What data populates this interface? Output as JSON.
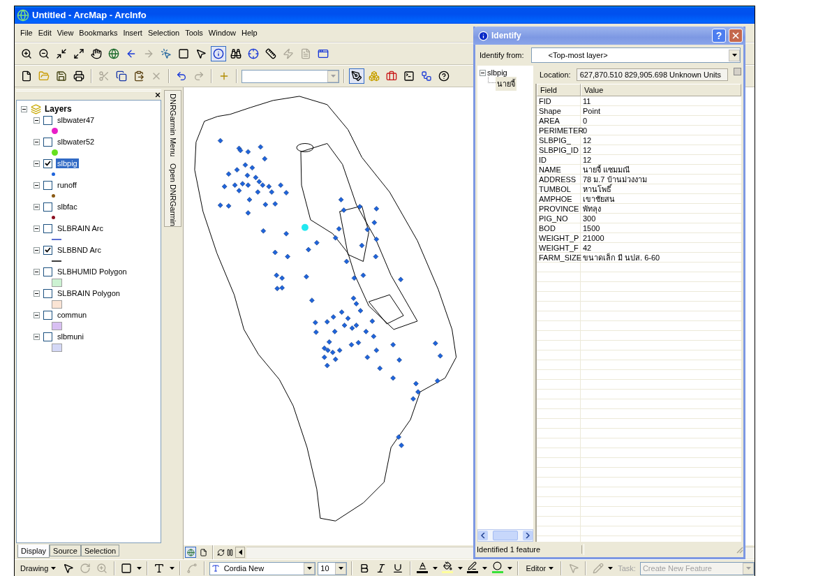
{
  "window": {
    "title": "Untitled - ArcMap - ArcInfo"
  },
  "menu": [
    "File",
    "Edit",
    "View",
    "Bookmarks",
    "Insert",
    "Selection",
    "Tools",
    "Window",
    "Help"
  ],
  "tools_navigation": [
    {
      "disabled": false,
      "selected": false
    },
    {
      "disabled": false,
      "selected": false
    },
    {
      "disabled": false,
      "selected": false
    },
    {
      "disabled": false,
      "selected": false
    },
    {
      "disabled": false,
      "selected": false
    },
    {
      "disabled": false,
      "selected": false
    },
    {
      "disabled": false,
      "selected": false
    },
    {
      "disabled": true,
      "selected": false
    },
    {
      "disabled": false,
      "selected": false
    },
    {
      "disabled": false,
      "selected": false
    },
    {
      "disabled": false,
      "selected": false
    },
    {
      "disabled": false,
      "selected": true
    },
    {
      "disabled": false,
      "selected": false
    },
    {
      "disabled": false,
      "selected": false
    },
    {
      "disabled": false,
      "selected": false
    },
    {
      "disabled": true,
      "selected": false
    },
    {
      "disabled": true,
      "selected": false
    },
    {
      "disabled": false,
      "selected": false
    }
  ],
  "tools_standard": [
    {
      "disabled": false,
      "selected": false
    },
    {
      "disabled": false,
      "selected": false
    },
    {
      "disabled": false,
      "selected": false
    },
    {
      "disabled": false,
      "selected": false
    },
    {
      "disabled": true,
      "selected": false
    },
    {
      "disabled": false,
      "selected": false
    },
    {
      "disabled": false,
      "selected": false
    },
    {
      "disabled": true,
      "selected": false
    },
    {
      "disabled": false,
      "selected": false
    },
    {
      "disabled": true,
      "selected": false
    },
    {
      "disabled": false,
      "selected": false
    },
    {
      "disabled": false,
      "selected": true
    },
    {
      "disabled": false,
      "selected": false
    },
    {
      "disabled": false,
      "selected": false
    },
    {
      "disabled": false,
      "selected": false
    },
    {
      "disabled": false,
      "selected": false
    },
    {
      "disabled": false,
      "selected": false
    }
  ],
  "toc": {
    "root": "Layers",
    "root_expanded": true,
    "layers": [
      {
        "name": "slbwater47",
        "checked": false,
        "selected": false,
        "expanded": true,
        "kind": "circle",
        "color": "#e81ec8"
      },
      {
        "name": "slbwater52",
        "checked": false,
        "selected": false,
        "expanded": true,
        "kind": "circle",
        "color": "#66e01e"
      },
      {
        "name": "slbpig",
        "checked": true,
        "selected": true,
        "expanded": true,
        "kind": "point",
        "color": "#1e64dc"
      },
      {
        "name": "runoff",
        "checked": false,
        "selected": false,
        "expanded": true,
        "kind": "point",
        "color": "#8a5a14"
      },
      {
        "name": "slbfac",
        "checked": false,
        "selected": false,
        "expanded": true,
        "kind": "point",
        "color": "#8c1020"
      },
      {
        "name": "SLBRAIN Arc",
        "checked": false,
        "selected": false,
        "expanded": true,
        "kind": "line",
        "color": "#5a6ed2"
      },
      {
        "name": "SLBBND Arc",
        "checked": true,
        "selected": false,
        "expanded": true,
        "kind": "line",
        "color": "#3c3c3c"
      },
      {
        "name": "SLBHUMID Polygon",
        "checked": false,
        "selected": false,
        "expanded": true,
        "kind": "fill",
        "color": "#ccf2d2"
      },
      {
        "name": "SLBRAIN Polygon",
        "checked": false,
        "selected": false,
        "expanded": true,
        "kind": "fill",
        "color": "#fae4d4"
      },
      {
        "name": "commun",
        "checked": false,
        "selected": false,
        "expanded": true,
        "kind": "fill",
        "color": "#d8bff2"
      },
      {
        "name": "slbmuni",
        "checked": false,
        "selected": false,
        "expanded": true,
        "kind": "fill",
        "color": "#d4d8f6"
      }
    ]
  },
  "toc_tabs": [
    {
      "label": "Display",
      "selected": true
    },
    {
      "label": "Source",
      "selected": false
    },
    {
      "label": "Selection",
      "selected": false
    }
  ],
  "side_strip": [
    "DNRGarmin Menu",
    "Open DNRGarmin"
  ],
  "view_buttons": [
    {
      "selected": true
    },
    {
      "selected": false
    }
  ],
  "identify": {
    "title": "Identify",
    "help": "?",
    "from_label": "Identify from:",
    "from_value": "<Top-most layer>",
    "tree": {
      "label": "slbpig",
      "expanded": true,
      "children": [
        {
          "label": "นายจี้",
          "selected": true
        }
      ]
    },
    "location_label": "Location:",
    "location_value": "627,870.510  829,905.698 Unknown Units",
    "columns": [
      "Field",
      "Value"
    ],
    "rows": [
      {
        "field": "FID",
        "value": "11"
      },
      {
        "field": "Shape",
        "value": "Point"
      },
      {
        "field": "AREA",
        "value": "0"
      },
      {
        "field": "PERIMETER",
        "value": "0"
      },
      {
        "field": "SLBPIG_",
        "value": "12"
      },
      {
        "field": "SLBPIG_ID",
        "value": "12"
      },
      {
        "field": "ID",
        "value": "12"
      },
      {
        "field": "NAME",
        "value": "นายจี้  แซมมณี"
      },
      {
        "field": "ADDRESS",
        "value": "78 ม.7  บ้านม่วงงาม"
      },
      {
        "field": "TUMBOL",
        "value": "หานโพธิ์"
      },
      {
        "field": "AMPHOE",
        "value": "เขาชัยสน"
      },
      {
        "field": "PROVINCE",
        "value": "พัทลุง"
      },
      {
        "field": "PIG_NO",
        "value": "300"
      },
      {
        "field": "BOD",
        "value": "1500"
      },
      {
        "field": "WEIGHT_P",
        "value": "21000"
      },
      {
        "field": "WEIGHT_F",
        "value": "42"
      },
      {
        "field": "FARM_SIZE",
        "value": "ขนาดเล็ก มี นปส. 6-60"
      }
    ],
    "status": "Identified 1 feature"
  },
  "drawing_toolbar": {
    "menu": "Drawing",
    "font": "Cordia New",
    "font_size": "10",
    "tools": [
      {
        "disabled": false
      },
      {
        "disabled": true
      },
      {
        "disabled": true
      },
      {
        "disabled": false
      },
      {
        "disabled": false
      },
      {
        "disabled": true
      },
      {
        "disabled": false
      },
      {
        "disabled": false
      },
      {
        "disabled": false
      }
    ],
    "color_buttons": [
      {
        "color": "#000000"
      },
      {
        "color": "#ffff9c"
      },
      {
        "color": "#000000"
      },
      {
        "color": "#38e038"
      }
    ]
  },
  "editor_toolbar": {
    "menu": "Editor",
    "tools": [
      {
        "disabled": true
      },
      {
        "disabled": true
      }
    ],
    "task_label": "Task:",
    "task": "Create New Feature",
    "task_disabled": true
  }
}
